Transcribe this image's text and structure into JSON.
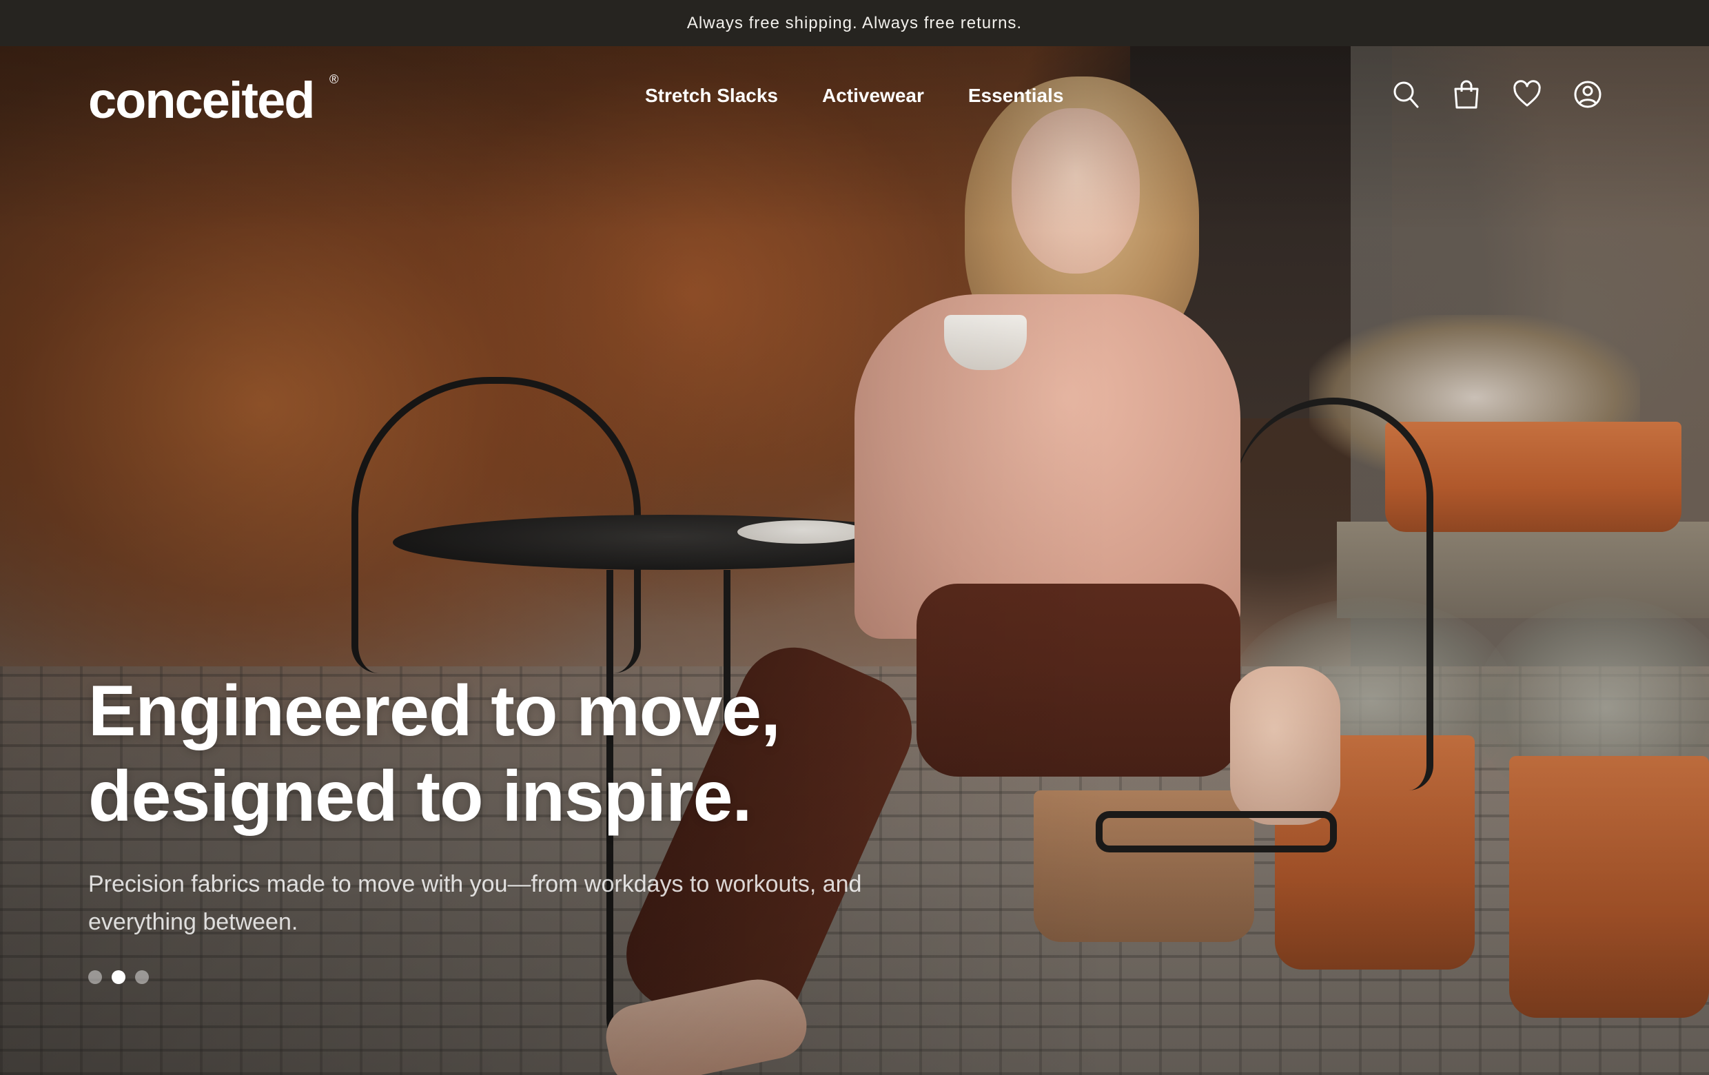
{
  "announcement": "Always free shipping. Always free returns.",
  "brand": {
    "name": "conceited",
    "mark": "®"
  },
  "nav": [
    {
      "label": "Stretch Slacks"
    },
    {
      "label": "Activewear"
    },
    {
      "label": "Essentials"
    }
  ],
  "header_icons": [
    "search-icon",
    "cart-icon",
    "wishlist-icon",
    "account-icon"
  ],
  "hero": {
    "headline_line1": "Engineered to move,",
    "headline_line2": "designed to inspire.",
    "subtext": "Precision fabrics made to move with you—from workdays to workouts, and everything between.",
    "slides": 3,
    "active_slide": 2
  },
  "colors": {
    "announcement_bg": "#262420",
    "text_on_hero": "#ffffff"
  }
}
